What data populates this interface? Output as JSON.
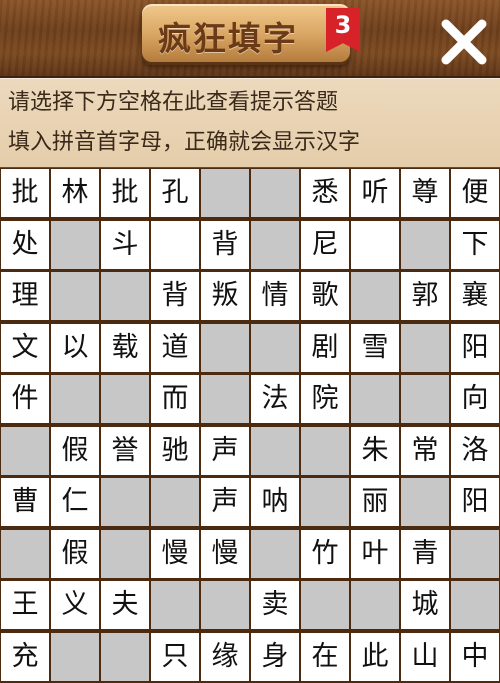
{
  "header": {
    "title": "疯狂填字",
    "level": "3",
    "close_icon": "close-x-icon"
  },
  "hints": {
    "line1": "请选择下方空格在此查看提示答题",
    "line2": "填入拼音首字母，正确就会显示汉字"
  },
  "colors": {
    "wood": "#7a4a22",
    "hint_bg": "#ecd9bd",
    "cell_open": "#ffffff",
    "cell_blocked": "#c7c7c7",
    "badge_red": "#d8222a"
  },
  "grid": [
    [
      "批",
      "林",
      "批",
      "孔",
      "#",
      "#",
      "悉",
      "听",
      "尊",
      "便"
    ],
    [
      "处",
      "#",
      "斗",
      "",
      "背",
      "#",
      "尼",
      "",
      "#",
      "下"
    ],
    [
      "理",
      "#",
      "#",
      "背",
      "叛",
      "情",
      "歌",
      "#",
      "郭",
      "襄"
    ],
    [
      "文",
      "以",
      "载",
      "道",
      "#",
      "#",
      "剧",
      "雪",
      "#",
      "阳"
    ],
    [
      "件",
      "#",
      "#",
      "而",
      "#",
      "法",
      "院",
      "#",
      "#",
      "向"
    ],
    [
      "#",
      "假",
      "誉",
      "驰",
      "声",
      "#",
      "#",
      "朱",
      "常",
      "洛"
    ],
    [
      "曹",
      "仁",
      "#",
      "#",
      "声",
      "呐",
      "#",
      "丽",
      "#",
      "阳"
    ],
    [
      "#",
      "假",
      "#",
      "慢",
      "慢",
      "#",
      "竹",
      "叶",
      "青",
      "#"
    ],
    [
      "王",
      "义",
      "夫",
      "#",
      "#",
      "卖",
      "#",
      "#",
      "城",
      "#"
    ],
    [
      "充",
      "#",
      "#",
      "只",
      "缘",
      "身",
      "在",
      "此",
      "山",
      "中"
    ]
  ]
}
